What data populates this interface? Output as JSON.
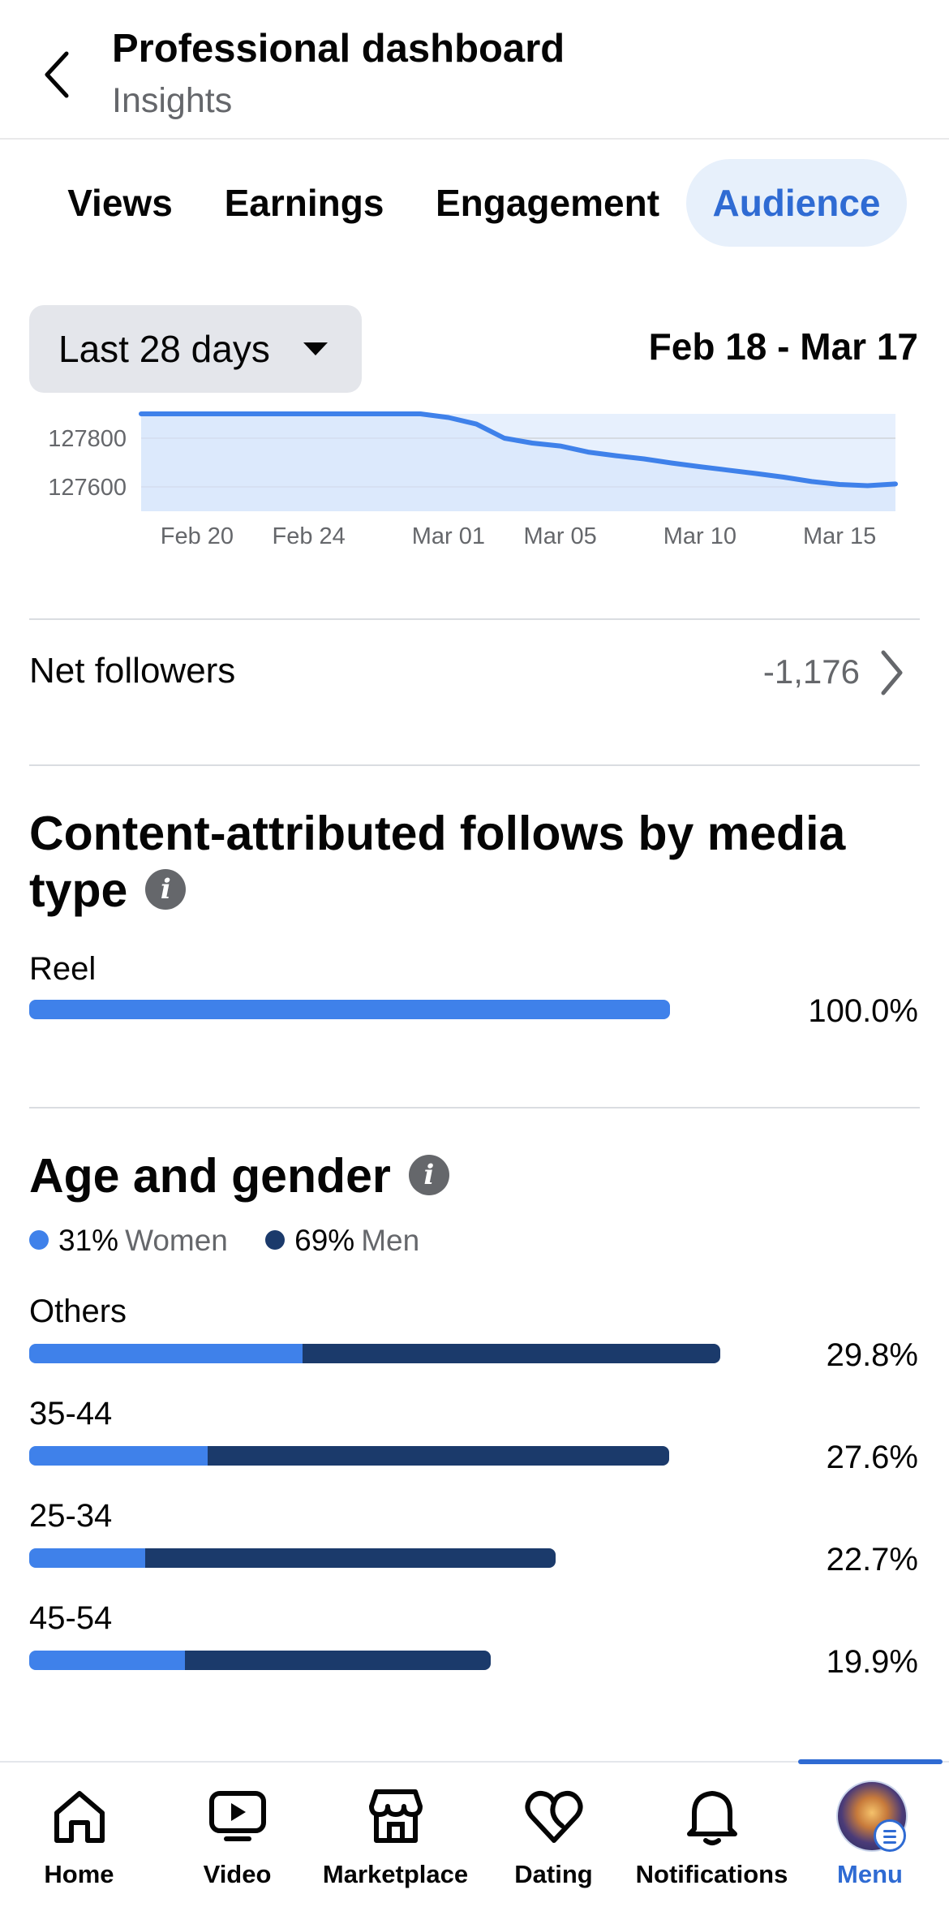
{
  "header": {
    "title": "Professional dashboard",
    "subtitle": "Insights"
  },
  "tabs": [
    {
      "label": "Views",
      "active": false
    },
    {
      "label": "Earnings",
      "active": false
    },
    {
      "label": "Engagement",
      "active": false
    },
    {
      "label": "Audience",
      "active": true
    }
  ],
  "range": {
    "label": "Last 28 days",
    "dates": "Feb 18 - Mar 17"
  },
  "chart_data": {
    "type": "area",
    "x_tick_labels": [
      "Feb 20",
      "Feb 24",
      "Mar 01",
      "Mar 05",
      "Mar 10",
      "Mar 15"
    ],
    "y_tick_labels": [
      "127800",
      "127600"
    ],
    "ylim": [
      127500,
      127900
    ],
    "grid": true,
    "series": [
      {
        "x": [
          "Feb 18",
          "Feb 19",
          "Feb 20",
          "Feb 21",
          "Feb 22",
          "Feb 23",
          "Feb 24",
          "Feb 25",
          "Feb 26",
          "Feb 27",
          "Feb 28",
          "Mar 01",
          "Mar 02",
          "Mar 03",
          "Mar 04",
          "Mar 05",
          "Mar 06",
          "Mar 07",
          "Mar 08",
          "Mar 09",
          "Mar 10",
          "Mar 11",
          "Mar 12",
          "Mar 13",
          "Mar 14",
          "Mar 15",
          "Mar 16",
          "Mar 17"
        ],
        "y": [
          127900,
          127900,
          127900,
          127900,
          127900,
          127900,
          127900,
          127900,
          127900,
          127900,
          127900,
          127885,
          127858,
          127800,
          127780,
          127768,
          127743,
          127728,
          127715,
          127698,
          127683,
          127669,
          127655,
          127640,
          127622,
          127610,
          127605,
          127612
        ]
      }
    ],
    "colors": {
      "line": "#3f81ea",
      "fill": "#e7f0fd"
    }
  },
  "net_followers": {
    "label": "Net followers",
    "value": "-1,176"
  },
  "media_type": {
    "title": "Content-attributed follows by media type",
    "rows": [
      {
        "label": "Reel",
        "percent": "100.0%",
        "value": 100.0
      }
    ]
  },
  "age_gender": {
    "title": "Age and gender",
    "legend": [
      {
        "pct": "31%",
        "name": "Women",
        "color": "#3f81ea"
      },
      {
        "pct": "69%",
        "name": "Men",
        "color": "#1b3a6b"
      }
    ],
    "rows": [
      {
        "label": "Others",
        "percent": "29.8%",
        "total": 29.8,
        "women_share": 0.396
      },
      {
        "label": "35-44",
        "percent": "27.6%",
        "total": 27.6,
        "women_share": 0.279
      },
      {
        "label": "25-34",
        "percent": "22.7%",
        "total": 22.7,
        "women_share": 0.221
      },
      {
        "label": "45-54",
        "percent": "19.9%",
        "total": 19.9,
        "women_share": 0.337
      }
    ]
  },
  "bottom_nav": [
    {
      "label": "Home",
      "icon": "home-icon"
    },
    {
      "label": "Video",
      "icon": "video-icon"
    },
    {
      "label": "Marketplace",
      "icon": "marketplace-icon"
    },
    {
      "label": "Dating",
      "icon": "dating-icon"
    },
    {
      "label": "Notifications",
      "icon": "bell-icon"
    },
    {
      "label": "Menu",
      "icon": "avatar",
      "active": true
    }
  ],
  "colors": {
    "accent": "#2f6bd3",
    "women": "#3f81ea",
    "men": "#1b3a6b"
  }
}
